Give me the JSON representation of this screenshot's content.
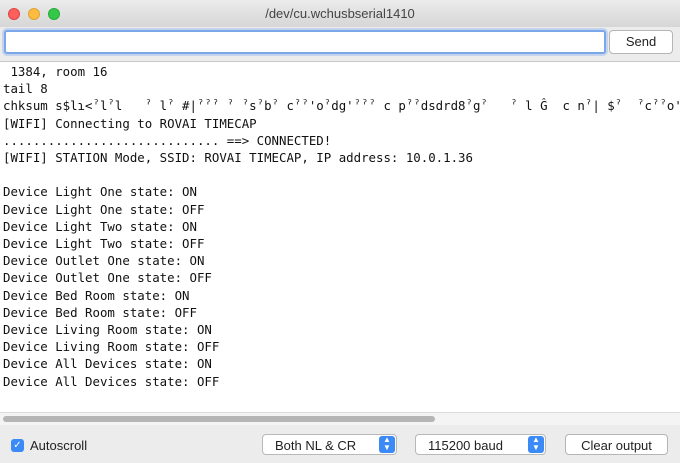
{
  "window": {
    "title": "/dev/cu.wchusbserial1410"
  },
  "input": {
    "value": "",
    "placeholder": ""
  },
  "send_label": "Send",
  "console_lines": [
    " 1384, room 16",
    "tail 8",
    "chksum s$lɿ<ˀlˀl   ˀ lˀ #|ˀˀˀ ˀ ˀsˀbˀ cˀˀ'oˀdg'ˀˀˀ c pˀˀdsdrd8ˀgˀ   ˀ l Ĝ  c nˀ| $ˀ  ˀcˀˀo'ˀlˀˀ",
    "[WIFI] Connecting to ROVAI TIMECAP",
    "............................. ==> CONNECTED!",
    "[WIFI] STATION Mode, SSID: ROVAI TIMECAP, IP address: 10.0.1.36",
    "",
    "Device Light One state: ON",
    "Device Light One state: OFF",
    "Device Light Two state: ON",
    "Device Light Two state: OFF",
    "Device Outlet One state: ON",
    "Device Outlet One state: OFF",
    "Device Bed Room state: ON",
    "Device Bed Room state: OFF",
    "Device Living Room state: ON",
    "Device Living Room state: OFF",
    "Device All Devices state: ON",
    "Device All Devices state: OFF"
  ],
  "autoscroll": {
    "label": "Autoscroll",
    "checked": true
  },
  "line_ending": {
    "selected": "Both NL & CR"
  },
  "baud": {
    "selected": "115200 baud"
  },
  "clear_label": "Clear output",
  "accent_color": "#3b8af5"
}
